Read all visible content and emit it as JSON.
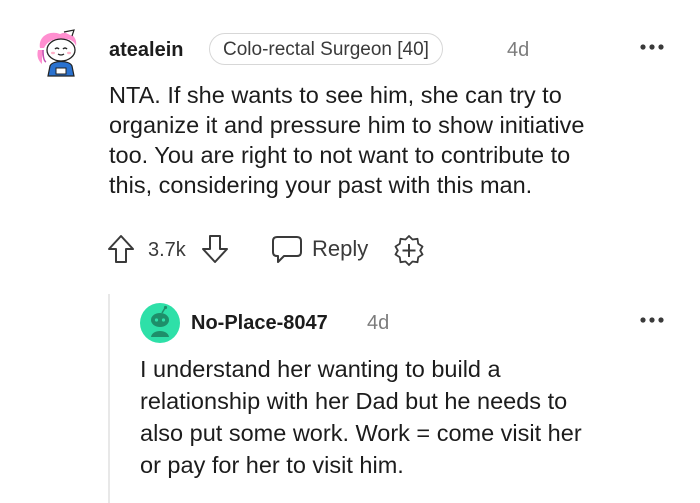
{
  "comment": {
    "username": "atealein",
    "flair": "Colo-rectal Surgeon [40]",
    "age": "4d",
    "body_lines": [
      "NTA. If she wants to see him, she can try to",
      "organize it and pressure him to show initiative",
      "too. You are right to not want to contribute to",
      "this, considering your past with this man."
    ],
    "score": "3.7k",
    "reply_label": "Reply"
  },
  "reply": {
    "username": "No-Place-8047",
    "age": "4d",
    "body_lines": [
      "I understand her wanting to build a",
      "relationship with her Dad but he needs to",
      "also put some work. Work = come visit her",
      "or pay for her to visit him."
    ]
  },
  "icons": {
    "avatar_1": "snoo-avatar-pink-hair",
    "avatar_2": "snoo-avatar-teal",
    "more": "more-options-icon",
    "upvote": "upvote-arrow-icon",
    "downvote": "downvote-arrow-icon",
    "reply": "speech-bubble-icon",
    "award": "award-plus-icon"
  },
  "colors": {
    "avatar_2_bg": "#2ee0a8",
    "thread_line": "#e8e8e8",
    "meta_text": "#7c7c7c"
  }
}
